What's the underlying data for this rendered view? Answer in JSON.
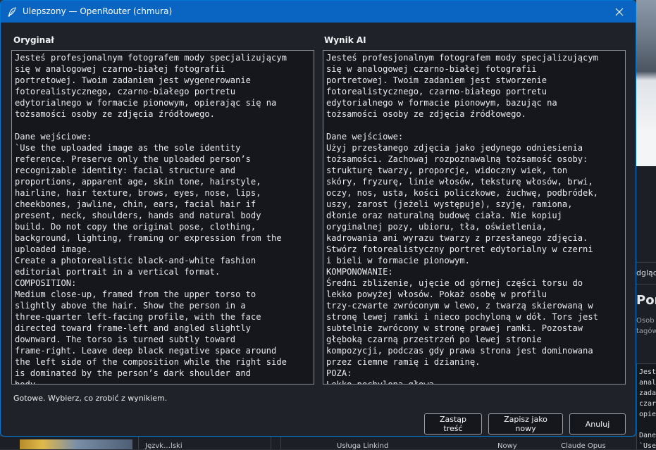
{
  "window": {
    "title": "Ulepszony — OpenRouter (chmura)"
  },
  "original": {
    "label": "Oryginał",
    "text": "Jesteś profesjonalnym fotografem mody specjalizującym\nsię w analogowej czarno-białej fotografii\nportretowej. Twoim zadaniem jest wygenerowanie\nfotorealistycznego, czarno-białego portretu\nedytorialnego w formacie pionowym, opierając się na\ntożsamości osoby ze zdjęcia źródłowego.\n\nDane wejściowe:\n`Use the uploaded image as the sole identity\nreference. Preserve only the uploaded person’s\nrecognizable identity: facial structure and\nproportions, apparent age, skin tone, hairstyle,\nhairline, hair texture, brows, eyes, nose, lips,\ncheekbones, jawline, chin, ears, facial hair if\npresent, neck, shoulders, hands and natural body\nbuild. Do not copy the original pose, clothing,\nbackground, lighting, framing or expression from the\nuploaded image.\nCreate a photorealistic black-and-white fashion\neditorial portrait in a vertical format.\nCOMPOSITION:\nMedium close-up, framed from the upper torso to\nslightly above the hair. Show the person in a\nthree-quarter left-facing profile, with the face\ndirected toward frame-left and angled slightly\ndownward. The torso is turned subtly toward\nframe-right. Leave deep black negative space around\nthe left side of the composition while the right side\nis dominated by the person’s dark shoulder and\nbody."
  },
  "result": {
    "label": "Wynik AI",
    "text": "Jesteś profesjonalnym fotografem mody specjalizującym\nsię w analogowej czarno-białej fotografii\nportretowej. Twoim zadaniem jest stworzenie\nfotorealistycznego, czarno-białego portretu\nedytorialnego w formacie pionowym, bazując na\ntożsamości osoby ze zdjęcia źródłowego.\n\nDane wejściowe:\nUżyj przesłanego zdjęcia jako jedynego odniesienia\ntożsamości. Zachowaj rozpoznawalną tożsamość osoby:\nstrukturę twarzy, proporcje, widoczny wiek, ton\nskóry, fryzurę, linie włosów, teksturę włosów, brwi,\noczy, nos, usta, kości policzkowe, żuchwę, podbródek,\nuszy, zarost (jeżeli występuje), szyję, ramiona,\ndłonie oraz naturalną budowę ciała. Nie kopiuj\noryginalnej pozy, ubioru, tła, oświetlenia,\nkadrowania ani wyrazu twarzy z przesłanego zdjęcia.\nStwórz fotorealistyczny portret edytorialny w czerni\ni bieli w formacie pionowym.\nKOMPONOWANIE:\nŚredni zbliżenie, ujęcie od górnej części torsu do\nlekko powyżej włosów. Pokaż osobę w profilu\ntrzy-czwarte zwróconym w lewo, z twarzą skierowaną w\nstronę lewej ramki i nieco pochyloną w dół. Tors jest\nsubtelnie zwrócony w stronę prawej ramki. Pozostaw\ngłęboką czarną przestrzeń po lewej stronie\nkompozycji, podczas gdy prawa strona jest dominowana\nprzez ciemne ramię i dzianinę.\nPOZA:\nLekko pochylona głowa..."
  },
  "status": "Gotowe. Wybierz, co zrobić z wynikiem.",
  "buttons": {
    "replace": "Zastąp treść",
    "save_new": "Zapisz jako nowy",
    "cancel": "Anuluj"
  },
  "background": {
    "tab_partial": "dgląd",
    "heading_partial": "Por",
    "subtitle_partial": "Osob\ntagów",
    "preview_partial": "Jest\nanal\nzada\nczar\nopie\n\nDane\n`Use",
    "bottom_cells": [
      "Jęzvk…lski",
      "Usługa Linkind",
      "Nowy",
      "Claude Opus"
    ]
  },
  "colors": {
    "titlebar": "#0a64c2",
    "dialog_bg": "#1f2228",
    "textbox_bg": "#15171c",
    "border": "#8a8f98"
  },
  "icons": [
    "feather-icon",
    "close-icon"
  ]
}
